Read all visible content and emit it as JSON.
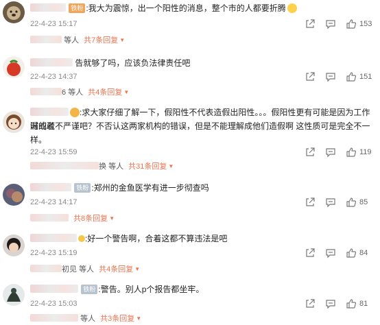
{
  "comments": [
    {
      "badge": "铁粉",
      "text": ":我大为震惊，出一个阳性的消息，整个市的人都要折腾",
      "date": "22-4-23 15:17",
      "likes": "153",
      "reply_users": "等人",
      "reply_link": "共7条回复"
    },
    {
      "badge": "",
      "text": "告就够了吗，应该负法律责任吧",
      "date": "22-4-23 14:37",
      "likes": "151",
      "reply_prefix": "6",
      "reply_users": "等人",
      "reply_link": "共4条回复"
    },
    {
      "badge": "",
      "text_line1": ":求大家仔细了解一下，假阳性不代表造假出阳性。。。假阳性更有可能是因为工作时的疏",
      "text_line2": "漏或者不严谨吧？不否认这两家机构的错误，但是不能理解成他们造假啊 这性质可是完全不一",
      "text_line3": "样。",
      "date": "22-4-23 15:59",
      "likes": "119",
      "reply_prefix": "换",
      "reply_users": "等人",
      "reply_link": "共31条回复"
    },
    {
      "badge": "铁粉",
      "text": ":郑州的金鱼医学有进一步彻查吗",
      "date": "22-4-23 14:17",
      "likes": "85",
      "reply_users": "",
      "reply_link": "共8条回复"
    },
    {
      "badge": "",
      "text": ":好一个警告啊，合着这都不算违法是吧",
      "date": "22-4-23 15:19",
      "likes": "84",
      "reply_prefix": "初见",
      "reply_users": "等人",
      "reply_link": "共4条回复"
    },
    {
      "badge": "铁粉",
      "text": ":警告。别人p个报告都坐牢。",
      "date": "22-4-23 15:03",
      "likes": "81",
      "reply_users": "等人",
      "reply_link": "共3条回复"
    }
  ],
  "colors": {
    "accent": "#eb7350",
    "meta": "#8a8a8a",
    "badge": "#f1a65c"
  },
  "icons": [
    "share-icon",
    "comment-icon",
    "like-icon"
  ]
}
